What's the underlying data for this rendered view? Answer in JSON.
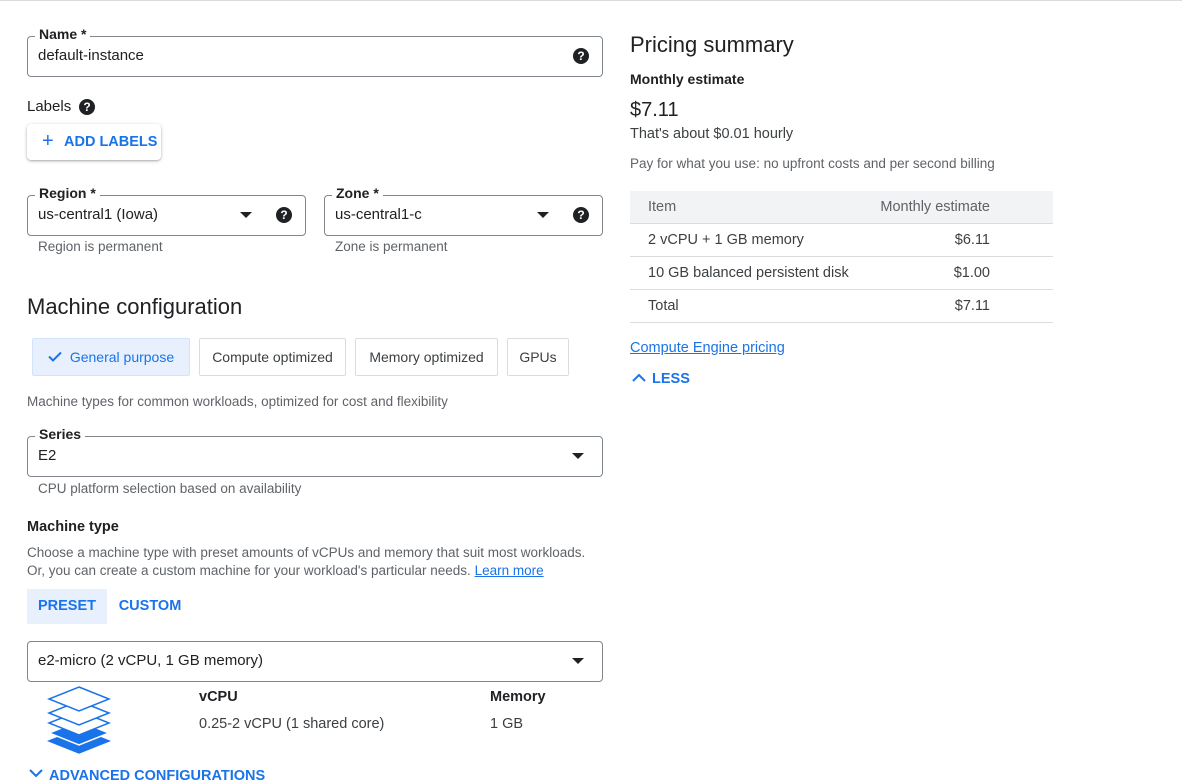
{
  "name_field": {
    "label": "Name *",
    "value": "default-instance"
  },
  "labels": {
    "heading": "Labels",
    "add_button": "ADD LABELS"
  },
  "region": {
    "label": "Region *",
    "value": "us-central1 (Iowa)",
    "hint": "Region is permanent"
  },
  "zone": {
    "label": "Zone *",
    "value": "us-central1-c",
    "hint": "Zone is permanent"
  },
  "machine_config": {
    "heading": "Machine configuration",
    "tabs": [
      "General purpose",
      "Compute optimized",
      "Memory optimized",
      "GPUs"
    ],
    "description": "Machine types for common workloads, optimized for cost and flexibility"
  },
  "series": {
    "label": "Series",
    "value": "E2",
    "hint": "CPU platform selection based on availability"
  },
  "machine_type": {
    "heading": "Machine type",
    "desc_line1": "Choose a machine type with preset amounts of vCPUs and memory that suit most workloads.",
    "desc_line2": "Or, you can create a custom machine for your workload's particular needs.",
    "learn_more": "Learn more",
    "preset_tab": "PRESET",
    "custom_tab": "CUSTOM",
    "selected": "e2-micro (2 vCPU, 1 GB memory)",
    "vcpu_label": "vCPU",
    "vcpu_value": "0.25-2 vCPU (1 shared core)",
    "memory_label": "Memory",
    "memory_value": "1 GB"
  },
  "advanced": "ADVANCED CONFIGURATIONS",
  "pricing": {
    "title": "Pricing summary",
    "subtitle": "Monthly estimate",
    "amount": "$7.11",
    "hourly": "That's about $0.01 hourly",
    "note": "Pay for what you use: no upfront costs and per second billing",
    "col_item": "Item",
    "col_estimate": "Monthly estimate",
    "rows": [
      {
        "item": "2 vCPU + 1 GB memory",
        "cost": "$6.11"
      },
      {
        "item": "10 GB balanced persistent disk",
        "cost": "$1.00"
      },
      {
        "item": "Total",
        "cost": "$7.11"
      }
    ],
    "link": "Compute Engine pricing",
    "less": "LESS"
  },
  "colors": {
    "accent": "#1a73e8",
    "chip_active_bg": "#e8f0fe"
  },
  "icons": [
    "help-icon",
    "plus-icon",
    "dropdown-caret-icon",
    "checkmark-icon",
    "layers-icon",
    "chevron-up-icon",
    "chevron-down-icon"
  ]
}
